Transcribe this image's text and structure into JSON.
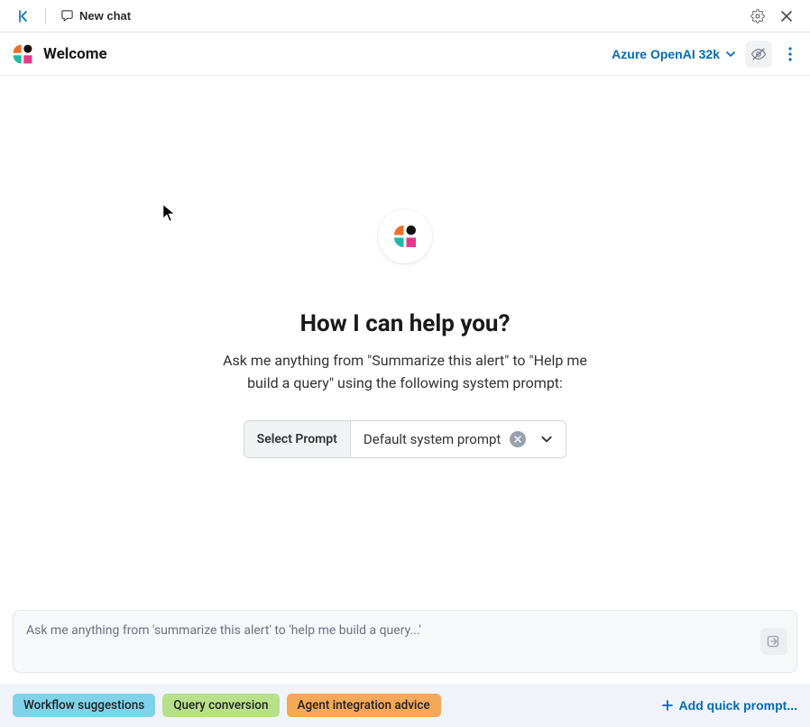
{
  "topbar": {
    "newchat_label": "New chat"
  },
  "header": {
    "title": "Welcome",
    "model_label": "Azure OpenAI 32k"
  },
  "welcome": {
    "headline": "How I can help you?",
    "subtext": "Ask me anything from \"Summarize this alert\" to \"Help me build a query\" using the following system prompt:",
    "select_label": "Select Prompt",
    "selected_prompt": "Default system prompt"
  },
  "input": {
    "placeholder": "Ask me anything from 'summarize this alert' to 'help me build a query...'"
  },
  "quick": {
    "items": [
      "Workflow suggestions",
      "Query conversion",
      "Agent integration advice"
    ],
    "add_label": "Add quick prompt..."
  }
}
